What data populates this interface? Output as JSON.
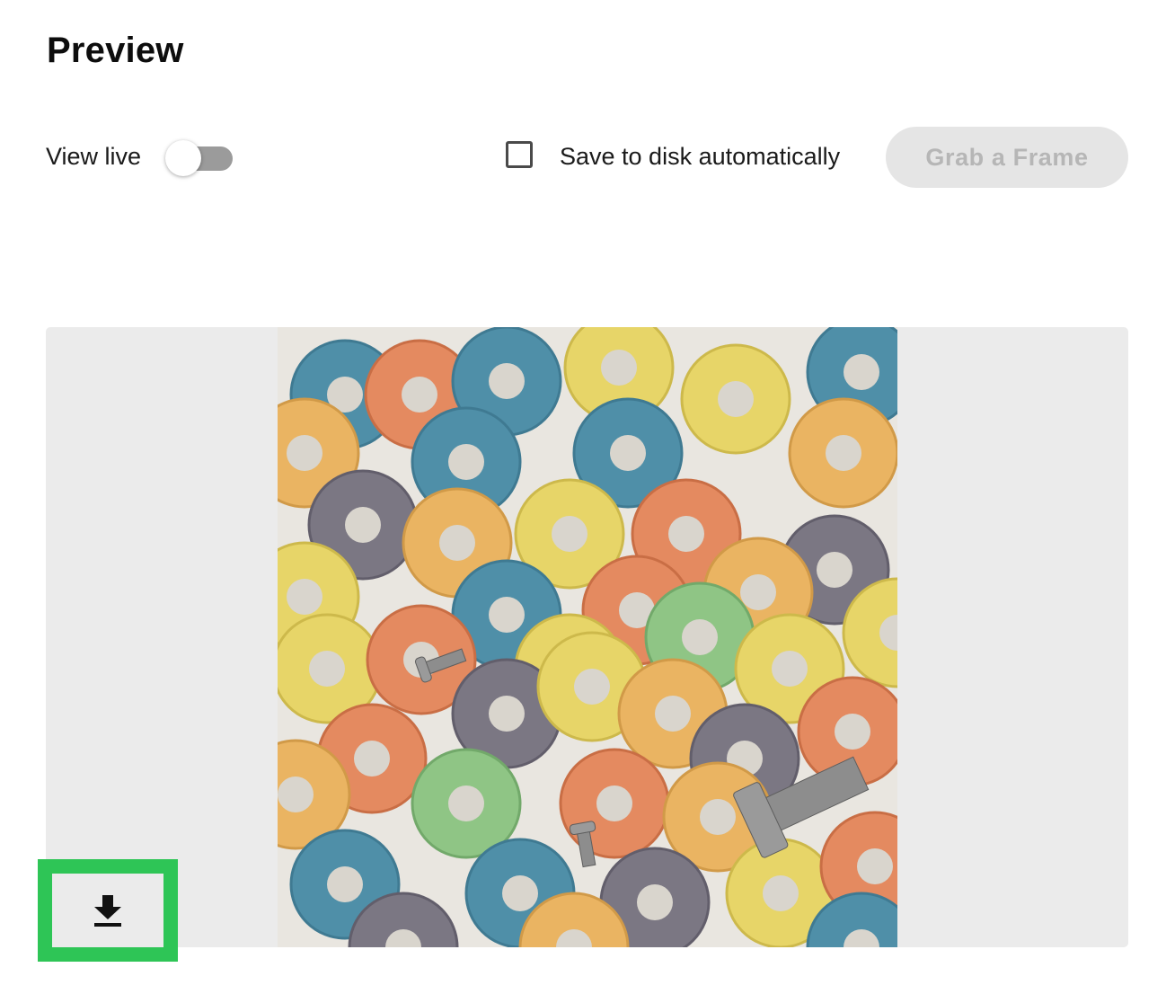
{
  "header": {
    "title": "Preview"
  },
  "controls": {
    "view_live_label": "View live",
    "view_live_on": false,
    "save_to_disk_label": "Save to disk automatically",
    "save_to_disk_checked": false,
    "grab_frame_label": "Grab a Frame",
    "grab_frame_enabled": false
  },
  "preview": {
    "image_subject": "colorful ring cereal loops with screws on white background",
    "download_icon": "download-icon",
    "highlight_color": "#2ec556"
  },
  "colors": {
    "toggle_track": "#9b9b9b",
    "button_disabled_bg": "#e5e5e5",
    "button_disabled_text": "#b6b6b6",
    "preview_bg": "#ebebeb"
  }
}
